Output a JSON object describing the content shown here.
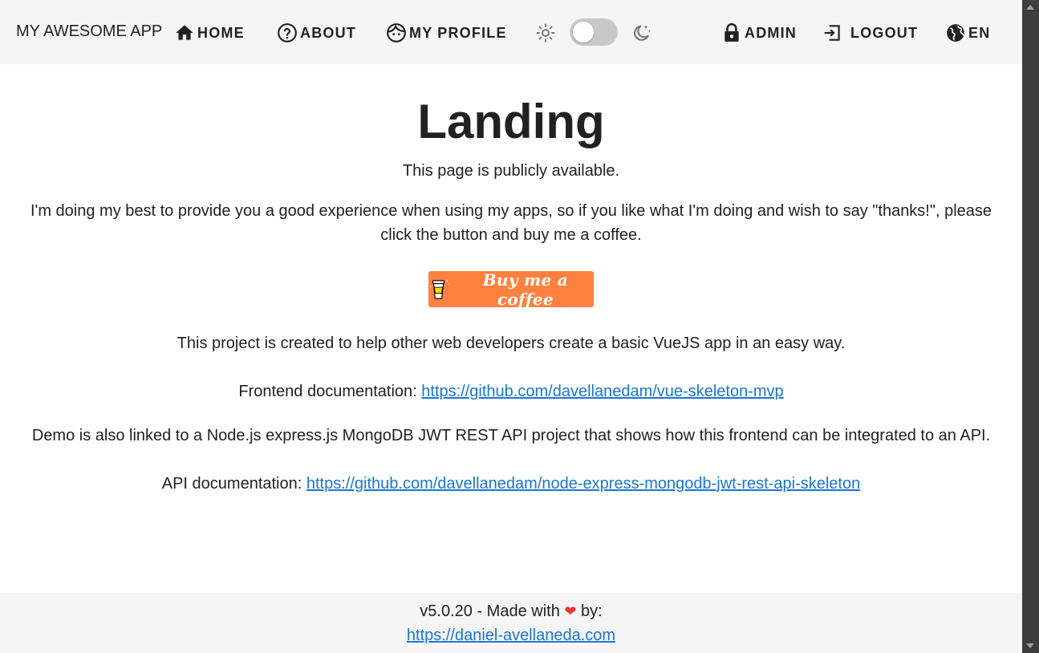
{
  "toolbar": {
    "brand": "MY AWESOME APP",
    "home": "HOME",
    "about": "ABOUT",
    "profile": "MY PROFILE",
    "admin": "ADMIN",
    "logout": "LOGOUT",
    "language": "EN",
    "theme_toggle_dark": false
  },
  "main": {
    "title": "Landing",
    "public_note": "This page is publicly available.",
    "thanks_text": "I'm doing my best to provide you a good experience when using my apps, so if you like what I'm doing and wish to say \"thanks!\", please click the button and buy me a coffee.",
    "coffee_button": "Buy me a coffee",
    "project_text": "This project is created to help other web developers create a basic VueJS app in an easy way.",
    "frontend_label": "Frontend documentation:",
    "frontend_url": "https://github.com/davellanedam/vue-skeleton-mvp",
    "demo_text": "Demo is also linked to a Node.js express.js MongoDB JWT REST API project that shows how this frontend can be integrated to an API.",
    "api_label": "API documentation:",
    "api_url": "https://github.com/davellanedam/node-express-mongodb-jwt-rest-api-skeleton"
  },
  "footer": {
    "version_prefix": "v5.0.20 - Made with",
    "by": "by:",
    "author_url": "https://daniel-avellaneda.com"
  },
  "colors": {
    "toolbar_bg": "#f5f5f5",
    "link": "#1976d2",
    "coffee_button": "#ff813f",
    "heart": "#e53935"
  }
}
